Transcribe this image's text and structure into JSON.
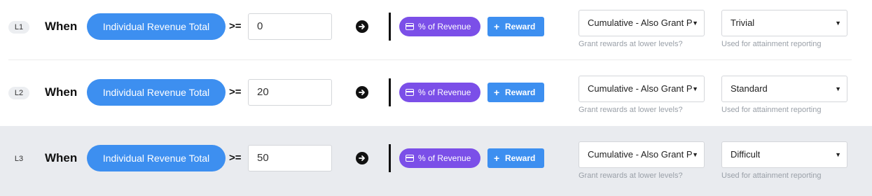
{
  "rows": [
    {
      "level": "L1",
      "when": "When",
      "metric": "Individual Revenue Total",
      "operator": ">=",
      "threshold": "0",
      "reward_type": "% of Revenue",
      "add_reward": "Reward",
      "cumulative": "Cumulative - Also Grant Prior",
      "cumulative_help": "Grant rewards at lower levels?",
      "difficulty": "Trivial",
      "difficulty_help": "Used for attainment reporting",
      "highlighted": false
    },
    {
      "level": "L2",
      "when": "When",
      "metric": "Individual Revenue Total",
      "operator": ">=",
      "threshold": "20",
      "reward_type": "% of Revenue",
      "add_reward": "Reward",
      "cumulative": "Cumulative - Also Grant Prior",
      "cumulative_help": "Grant rewards at lower levels?",
      "difficulty": "Standard",
      "difficulty_help": "Used for attainment reporting",
      "highlighted": false
    },
    {
      "level": "L3",
      "when": "When",
      "metric": "Individual Revenue Total",
      "operator": ">=",
      "threshold": "50",
      "reward_type": "% of Revenue",
      "add_reward": "Reward",
      "cumulative": "Cumulative - Also Grant Prior",
      "cumulative_help": "Grant rewards at lower levels?",
      "difficulty": "Difficult",
      "difficulty_help": "Used for attainment reporting",
      "highlighted": true
    }
  ],
  "icons": {
    "arrow": "arrow-right-circle-icon",
    "reward_chip": "card-icon",
    "add": "plus-icon",
    "caret": "caret-down-icon"
  },
  "colors": {
    "metric_pill": "#3d8ff0",
    "reward_chip": "#7b4fe8",
    "add_button": "#3d8ff0",
    "highlight_row": "#e9ebef"
  }
}
